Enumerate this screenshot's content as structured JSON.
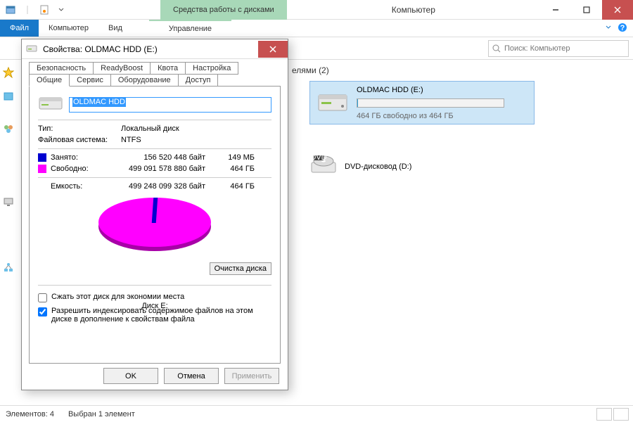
{
  "window": {
    "title": "Компьютер",
    "context_tab": "Средства работы с дисками"
  },
  "ribbon": {
    "file": "Файл",
    "computer": "Компьютер",
    "view": "Вид",
    "manage": "Управление"
  },
  "search": {
    "placeholder": "Поиск: Компьютер"
  },
  "content": {
    "category_trunc": "елями (2)",
    "drive": {
      "name": "OLDMAC HDD (E:)",
      "sub": "464 ГБ свободно из 464 ГБ"
    },
    "dvd": "DVD-дисковод (D:)"
  },
  "status": {
    "count": "Элементов: 4",
    "sel": "Выбран 1 элемент"
  },
  "dialog": {
    "title": "Свойства: OLDMAC HDD (E:)",
    "tabs_row1": [
      "Безопасность",
      "ReadyBoost",
      "Квота",
      "Настройка"
    ],
    "tabs_row2": [
      "Общие",
      "Сервис",
      "Оборудование",
      "Доступ"
    ],
    "name": "OLDMAC HDD",
    "type_label": "Тип:",
    "type_value": "Локальный диск",
    "fs_label": "Файловая система:",
    "fs_value": "NTFS",
    "used_label": "Занято:",
    "used_bytes": "156 520 448 байт",
    "used_h": "149 МБ",
    "free_label": "Свободно:",
    "free_bytes": "499 091 578 880 байт",
    "free_h": "464 ГБ",
    "cap_label": "Емкость:",
    "cap_bytes": "499 248 099 328 байт",
    "cap_h": "464 ГБ",
    "disk_label": "Диск E:",
    "cleanup": "Очистка диска",
    "chk_compress": "Сжать этот диск для экономии места",
    "chk_index": "Разрешить индексировать содержимое файлов на этом диске в дополнение к свойствам файла",
    "ok": "OK",
    "cancel": "Отмена",
    "apply": "Применить"
  }
}
